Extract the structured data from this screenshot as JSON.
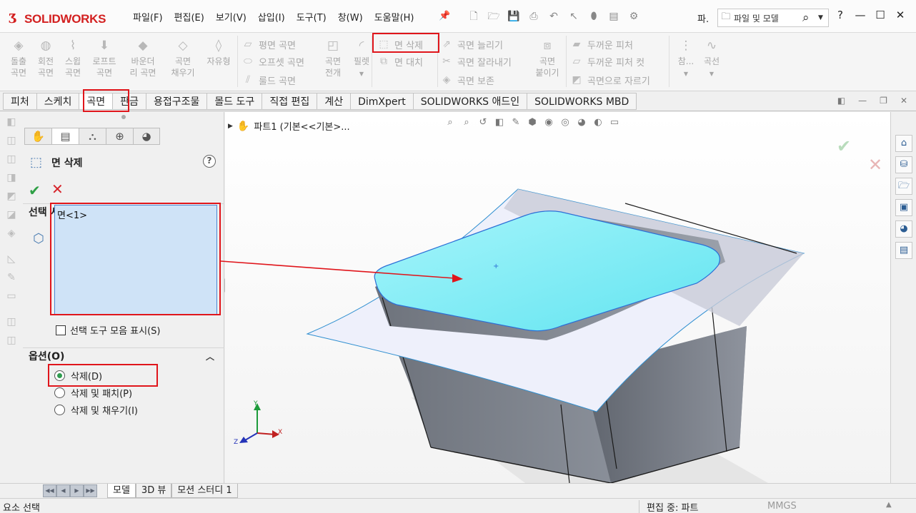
{
  "app": {
    "brand": "SOLIDWORKS",
    "menu": [
      "파일(F)",
      "편집(E)",
      "보기(V)",
      "삽입(I)",
      "도구(T)",
      "창(W)",
      "도움말(H)"
    ],
    "qa_truncated": "파.",
    "search_label": "파일 및 모델"
  },
  "ribbon": {
    "big": [
      {
        "l1": "돌출",
        "l2": "곡면",
        "icon": "extrude-surface-icon"
      },
      {
        "l1": "회전",
        "l2": "곡면",
        "icon": "revolve-surface-icon"
      },
      {
        "l1": "스윕",
        "l2": "곡면",
        "icon": "sweep-surface-icon"
      },
      {
        "l1": "로프트",
        "l2": "곡면",
        "icon": "loft-surface-icon"
      },
      {
        "l1": "바운더",
        "l2": "리 곡면",
        "icon": "boundary-surface-icon"
      },
      {
        "l1": "곡면",
        "l2": "채우기",
        "icon": "fill-surface-icon"
      },
      {
        "l1": "자유형",
        "l2": "",
        "icon": "freeform-icon"
      }
    ],
    "col1": [
      "평면 곡면",
      "오프셋 곡면",
      "룰드 곡면"
    ],
    "flatten": {
      "l1": "곡면",
      "l2": "전개"
    },
    "fillet": "필렛",
    "col2": [
      "면 삭제",
      "면 대치"
    ],
    "col3": [
      "곡면 늘리기",
      "곡면 잘라내기",
      "곡면 보존"
    ],
    "knit": {
      "l1": "곡면",
      "l2": "붙이기"
    },
    "col4": [
      "두꺼운 피처",
      "두꺼운 피처 컷",
      "곡면으로 자르기"
    ],
    "ref": "참...",
    "curve": "곡선"
  },
  "tabs": [
    "피처",
    "스케치",
    "곡면",
    "판금",
    "용접구조물",
    "몰드 도구",
    "직접 편집",
    "계산",
    "DimXpert",
    "SOLIDWORKS 애드인",
    "SOLIDWORKS MBD"
  ],
  "active_tab": "곡면",
  "property_manager": {
    "title": "면 삭제",
    "selection_header": "선택 사항",
    "selected_item": "면<1>",
    "show_toolbar_label": "선택 도구 모음 표시(S)",
    "options_header": "옵션(O)",
    "options": [
      "삭제(D)",
      "삭제 및 패치(P)",
      "삭제 및 채우기(I)"
    ],
    "selected_option": "삭제(D)"
  },
  "viewport": {
    "tree_item": "파트1  (기본<<기본>...",
    "axes": {
      "x": "X",
      "y": "Y",
      "z": "Z"
    }
  },
  "bottom_tabs": [
    "모델",
    "3D 뷰",
    "모션 스터디 1"
  ],
  "status": {
    "left": "요소 선택",
    "mode": "편집 중: 파트",
    "units": "MMGS"
  },
  "colors": {
    "highlight_red": "#e0151b",
    "selected_face": "#80f0f8",
    "surface": "#eef0fb",
    "body_gray": "#7d828c",
    "brand_red": "#d32020"
  }
}
